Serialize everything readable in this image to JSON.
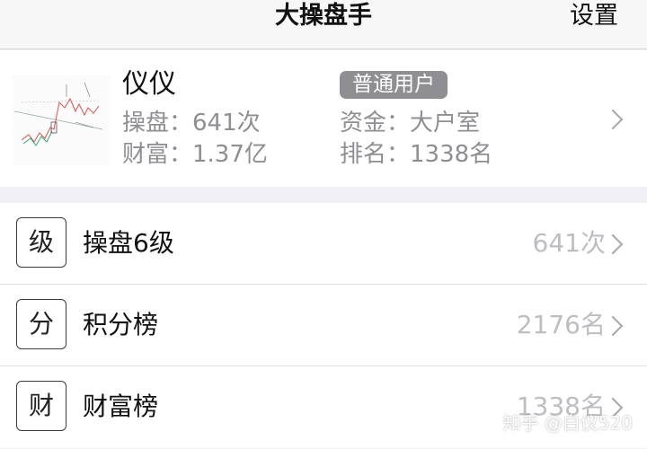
{
  "header": {
    "title": "大操盘手",
    "right_label": "设置"
  },
  "profile": {
    "name": "仪仪",
    "badge": "普通用户",
    "trades": "操盘：641次",
    "wealth": "财富：1.37亿",
    "funds": "资金：大户室",
    "rank": "排名：1338名"
  },
  "list": [
    {
      "icon": "级",
      "label": "操盘6级",
      "value": "641次"
    },
    {
      "icon": "分",
      "label": "积分榜",
      "value": "2176名"
    },
    {
      "icon": "财",
      "label": "财富榜",
      "value": "1338名"
    }
  ],
  "watermark": "知乎 @白仪520"
}
